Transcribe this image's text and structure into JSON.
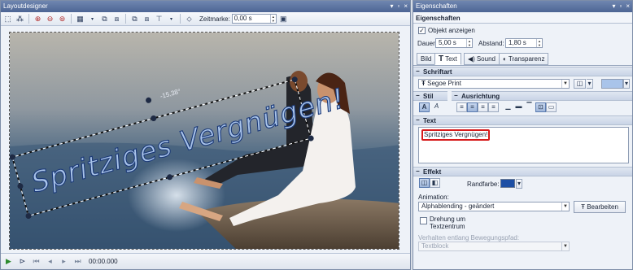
{
  "left_panel": {
    "title": "Layoutdesigner",
    "title_buttons": [
      "▾",
      "▫",
      "×"
    ],
    "toolbar": {
      "zeitmarke_label": "Zeitmarke:",
      "zeitmarke_value": "0,00 s"
    },
    "canvas": {
      "text_object": "Spritziges Vergnügen!",
      "rotation_label": "-15,38°"
    },
    "bottom": {
      "time": "00:00.000"
    }
  },
  "right_panel": {
    "title": "Eigenschaften",
    "title_buttons": [
      "▾",
      "▫",
      "×"
    ],
    "header": "Eigenschaften",
    "objekt_anzeigen": "Objekt anzeigen",
    "dauer_label": "Dauer:",
    "dauer_value": "5,00 s",
    "abstand_label": "Abstand:",
    "abstand_value": "1,80 s",
    "tabs": [
      {
        "label": "Bild",
        "icon": "image-icon"
      },
      {
        "label": "Text",
        "icon": "text-icon"
      },
      {
        "label": "Sound",
        "icon": "speaker-icon"
      },
      {
        "label": "Transparenz",
        "icon": "transparency-icon"
      }
    ],
    "schriftart": {
      "header": "Schriftart",
      "font": "Segoe Print"
    },
    "stil_label": "Stil",
    "ausrichtung_label": "Ausrichtung",
    "text_section": {
      "header": "Text",
      "content": "Spritziges Vergnügen!"
    },
    "effekt": {
      "header": "Effekt",
      "randfarbe_label": "Randfarbe:",
      "animation_label": "Animation:",
      "animation_value": "Alphablending - geändert",
      "bearbeiten_label": "Bearbeiten",
      "drehung_line1": "Drehung um",
      "drehung_line2": "Textzentrum",
      "bewegungspfad_label": "Verhalten entlang Bewegungspfad:",
      "bewegungspfad_value": "Textblock"
    }
  },
  "colors": {
    "accent": "#4d6594",
    "font_color": "#a9c4ea",
    "randfarbe": "#1d4fa5",
    "text_highlight": "#d61a1a"
  }
}
